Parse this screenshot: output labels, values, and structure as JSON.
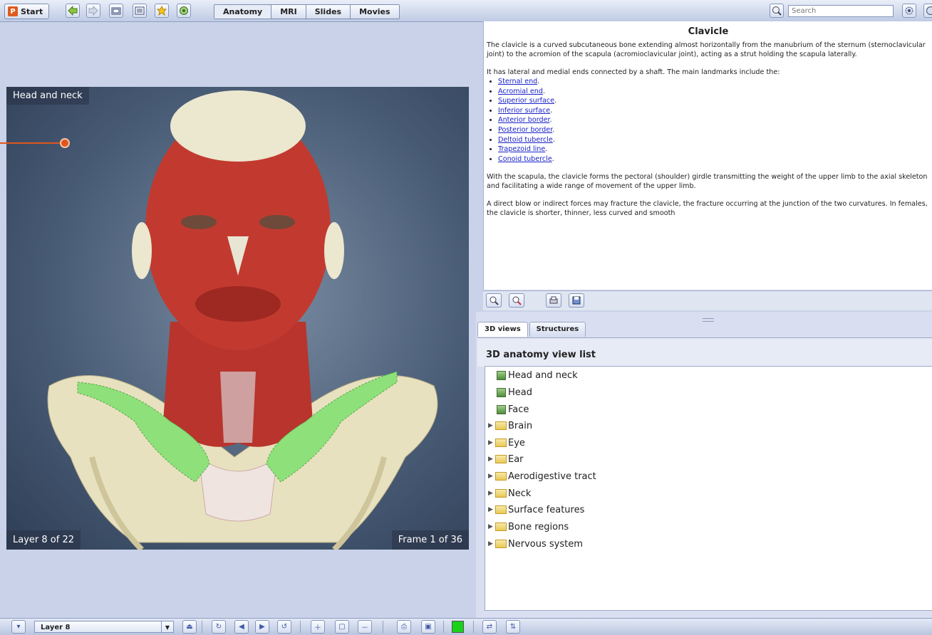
{
  "toolbar": {
    "start_label": "Start",
    "start_logo": "P",
    "icons": [
      "back-arrow-icon",
      "forward-arrow-icon",
      "folder-icon",
      "list-icon",
      "favorites-star-icon",
      "global-icon"
    ],
    "tabs": [
      {
        "label": "Anatomy",
        "active": true
      },
      {
        "label": "MRI",
        "active": false
      },
      {
        "label": "Slides",
        "active": false
      },
      {
        "label": "Movies",
        "active": false
      }
    ],
    "search_placeholder": "Search"
  },
  "viewer": {
    "title": "Head and neck",
    "layer_status": "Layer 8 of 22",
    "frame_status": "Frame 1 of 36",
    "highlight_color": "#8de07a"
  },
  "text_panel": {
    "title": "Clavicle",
    "para1": "The clavicle is a curved subcutaneous bone extending almost horizontally from the manubrium of the sternum (sternoclavicular joint) to the acromion of the scapula (acromioclavicular joint), acting as a strut holding the scapula laterally.",
    "para2": "It has lateral and medial ends connected by a shaft. The main landmarks include the:",
    "landmarks": [
      "Sternal end",
      "Acromial end",
      "Superior surface",
      "Inferior surface",
      "Anterior border",
      "Posterior border",
      "Deltoid tubercle",
      "Trapezoid line",
      "Conoid tubercle"
    ],
    "para3": "With the scapula, the clavicle forms the pectoral (shoulder) girdle transmitting the weight of the upper limb to the axial skeleton and facilitating a wide range of movement of the upper limb.",
    "para4": "A direct blow or indirect forces may fracture the clavicle, the fracture occurring at the junction of the two curvatures. In females, the clavicle is shorter, thinner, less curved and smooth"
  },
  "lower_panel": {
    "tabs": [
      {
        "label": "3D views",
        "active": true
      },
      {
        "label": "Structures",
        "active": false
      }
    ],
    "list_title": "3D anatomy view list",
    "items": [
      {
        "label": "Head and neck",
        "type": "view"
      },
      {
        "label": "Head",
        "type": "view"
      },
      {
        "label": "Face",
        "type": "view"
      },
      {
        "label": "Brain",
        "type": "folder"
      },
      {
        "label": "Eye",
        "type": "folder"
      },
      {
        "label": "Ear",
        "type": "folder"
      },
      {
        "label": "Aerodigestive tract",
        "type": "folder"
      },
      {
        "label": "Neck",
        "type": "folder"
      },
      {
        "label": "Surface features",
        "type": "folder"
      },
      {
        "label": "Bone regions",
        "type": "folder"
      },
      {
        "label": "Nervous system",
        "type": "folder"
      }
    ]
  },
  "bottom_bar": {
    "layer_select_value": "Layer 8",
    "color_swatch": "#1ad21a"
  },
  "colors": {
    "accent": "#e0561d",
    "link": "#1a22c8"
  }
}
